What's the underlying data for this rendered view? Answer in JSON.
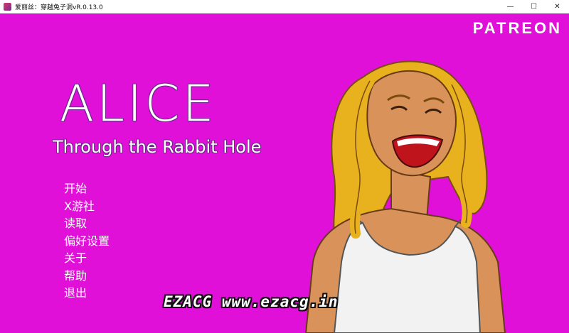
{
  "window": {
    "title": "爱丽丝：穿越兔子洞vR.0.13.0",
    "min_glyph": "—",
    "max_glyph": "☐",
    "close_glyph": "✕"
  },
  "game": {
    "background_color": "#e010d8",
    "patreon_label": "PATREON",
    "title": "ALICE",
    "subtitle": "Through the Rabbit Hole",
    "menu": [
      {
        "label": "开始"
      },
      {
        "label": "X游社"
      },
      {
        "label": "读取"
      },
      {
        "label": "偏好设置"
      },
      {
        "label": "关于"
      },
      {
        "label": "帮助"
      },
      {
        "label": "退出"
      }
    ],
    "watermark": "EZACG  www.ezacg.in"
  }
}
